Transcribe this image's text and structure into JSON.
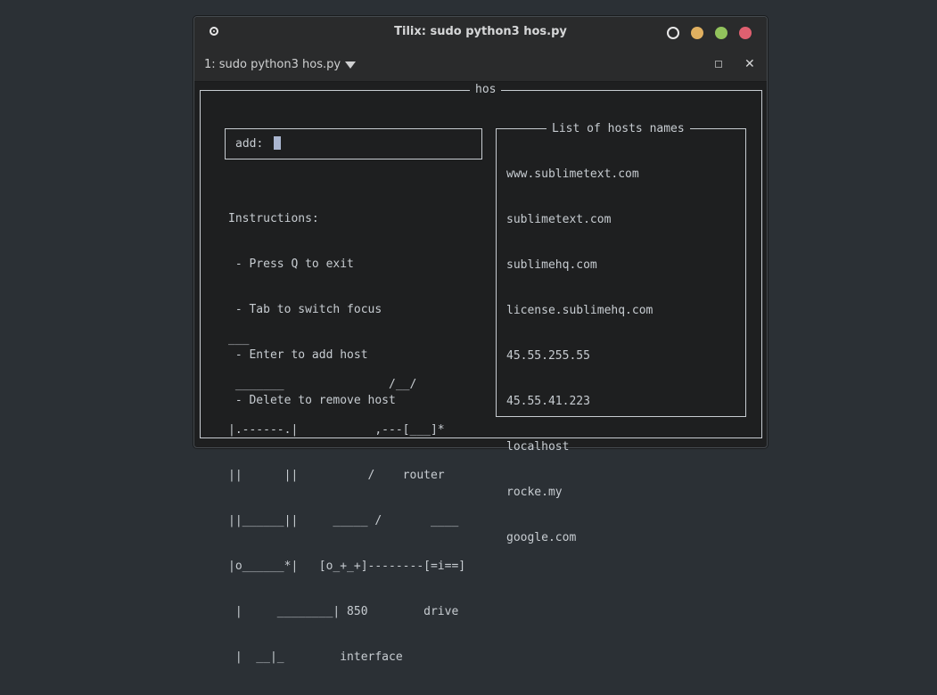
{
  "window": {
    "title": "Tilix: sudo python3 hos.py",
    "colors": {
      "minimize": "#e0b060",
      "maximize": "#92c35c",
      "close": "#e06070"
    }
  },
  "tab": {
    "label": "1: sudo python3 hos.py",
    "close_glyph": "✕"
  },
  "app": {
    "frame_title": "hos",
    "add_label": "add:",
    "add_value": "",
    "instructions": [
      "Instructions:",
      " - Press Q to exit",
      " - Tab to switch focus",
      " - Enter to add host",
      " - Delete to remove host"
    ],
    "ascii_art": [
      "___",
      " _______               /__/",
      "|.------.|           ,---[___]*",
      "||      ||          /    router",
      "||______||     _____ /       ____",
      "|o______*|   [o_+_+]--------[=i==]",
      " |     ________| 850        drive",
      " |  __|_        interface"
    ],
    "hosts_title": "List of hosts names",
    "hosts": [
      "www.sublimetext.com",
      "sublimetext.com",
      "sublimehq.com",
      "license.sublimehq.com",
      "45.55.255.55",
      "45.55.41.223",
      "localhost",
      "rocke.my",
      "google.com"
    ]
  }
}
